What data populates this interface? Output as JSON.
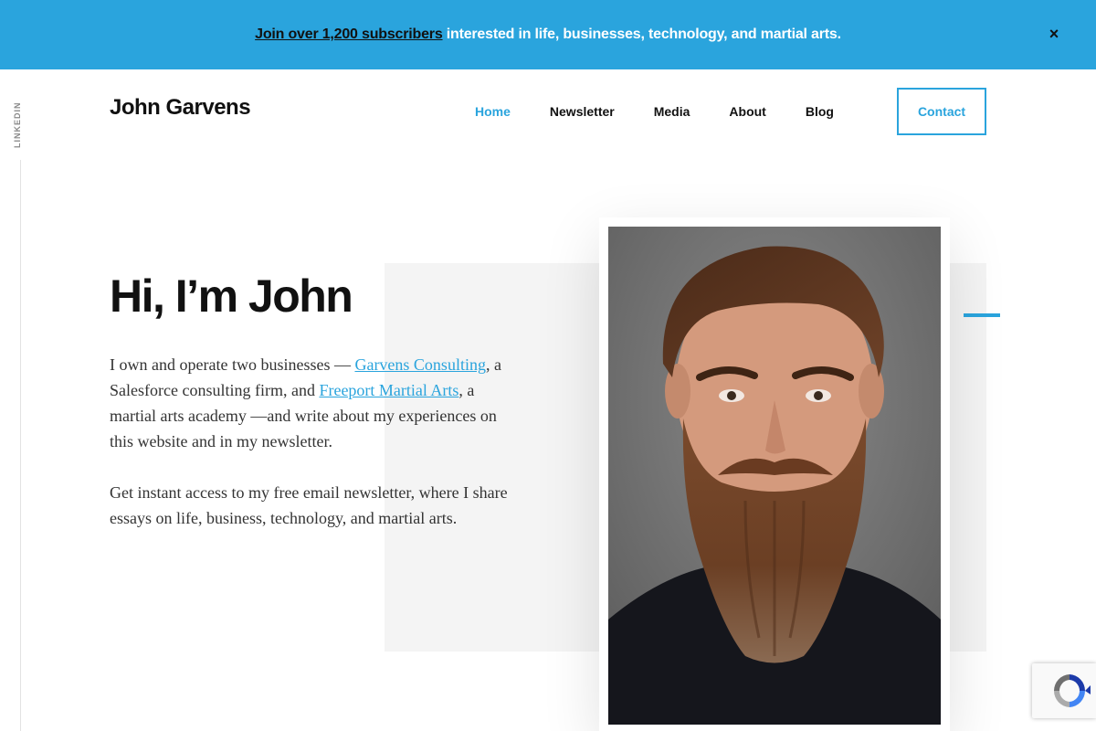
{
  "banner": {
    "link_text": "Join over 1,200 subscribers",
    "text": " interested in life, businesses, technology, and martial arts.",
    "close_label": "×"
  },
  "side": {
    "linkedin_label": "LINKEDIN"
  },
  "header": {
    "site_title": "John Garvens",
    "nav": [
      {
        "label": "Home",
        "active": true
      },
      {
        "label": "Newsletter"
      },
      {
        "label": "Media"
      },
      {
        "label": "About"
      },
      {
        "label": "Blog"
      }
    ],
    "contact_label": "Contact"
  },
  "hero": {
    "heading": "Hi, I’m John",
    "p1": {
      "t1": "I own and operate two businesses — ",
      "link1": "Garvens Consulting",
      "t2": ", a Salesforce consulting firm, and ",
      "link2": "Freeport Martial Arts",
      "t3": ", a martial arts academy —and write about my experiences on this website and in my newsletter."
    },
    "p2": "Get instant access to my free email newsletter, where I share essays on life, business, technology, and martial arts."
  },
  "colors": {
    "accent": "#2aa4dd",
    "banner_bg": "#2aa4dd",
    "hero_block": "#f4f4f4"
  }
}
